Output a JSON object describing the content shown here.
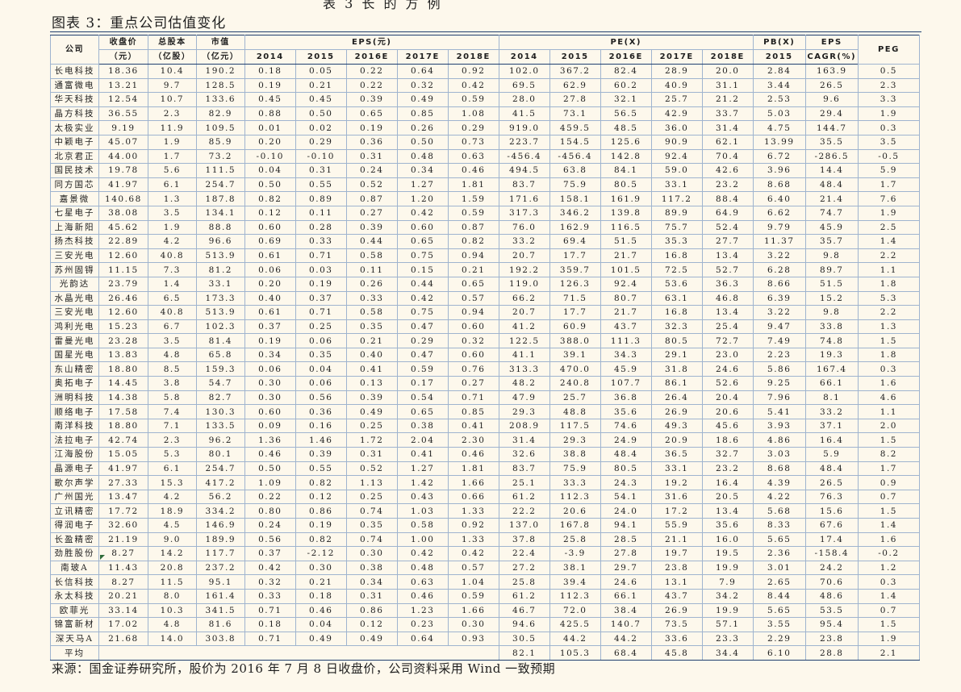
{
  "cut_title": "表 3 长 的 方 例",
  "figure_title": "图表 3：重点公司估值变化",
  "headers": {
    "company": "公司",
    "close_price": "收盘价",
    "close_price_unit": "（元）",
    "total_shares": "总股本",
    "total_shares_unit": "（亿股）",
    "market_cap": "市值",
    "market_cap_unit": "（亿元）",
    "eps_group": "EPS(元)",
    "pe_group": "PE(X)",
    "pb_group": "PB(X)",
    "pb_year": "2015",
    "eps_cagr": "EPS",
    "eps_cagr_unit": "CAGR(%)",
    "peg": "PEG",
    "years": [
      "2014",
      "2015",
      "2016E",
      "2017E",
      "2018E"
    ]
  },
  "rows": [
    [
      "长电科技",
      "18.36",
      "10.4",
      "190.2",
      "0.18",
      "0.05",
      "0.22",
      "0.64",
      "0.92",
      "102.0",
      "367.2",
      "82.4",
      "28.9",
      "20.0",
      "2.84",
      "163.9",
      "0.5"
    ],
    [
      "通富微电",
      "13.21",
      "9.7",
      "128.5",
      "0.19",
      "0.21",
      "0.22",
      "0.32",
      "0.42",
      "69.5",
      "62.9",
      "60.2",
      "40.9",
      "31.1",
      "3.44",
      "26.5",
      "2.3"
    ],
    [
      "华天科技",
      "12.54",
      "10.7",
      "133.6",
      "0.45",
      "0.45",
      "0.39",
      "0.49",
      "0.59",
      "28.0",
      "27.8",
      "32.1",
      "25.7",
      "21.2",
      "2.53",
      "9.6",
      "3.3"
    ],
    [
      "晶方科技",
      "36.55",
      "2.3",
      "82.9",
      "0.88",
      "0.50",
      "0.65",
      "0.85",
      "1.08",
      "41.5",
      "73.1",
      "56.5",
      "42.9",
      "33.7",
      "5.03",
      "29.4",
      "1.9"
    ],
    [
      "太极实业",
      "9.19",
      "11.9",
      "109.5",
      "0.01",
      "0.02",
      "0.19",
      "0.26",
      "0.29",
      "919.0",
      "459.5",
      "48.5",
      "36.0",
      "31.4",
      "4.75",
      "144.7",
      "0.3"
    ],
    [
      "中颖电子",
      "45.07",
      "1.9",
      "85.9",
      "0.20",
      "0.29",
      "0.36",
      "0.50",
      "0.73",
      "223.7",
      "154.5",
      "125.6",
      "90.9",
      "62.1",
      "13.99",
      "35.5",
      "3.5"
    ],
    [
      "北京君正",
      "44.00",
      "1.7",
      "73.2",
      "-0.10",
      "-0.10",
      "0.31",
      "0.48",
      "0.63",
      "-456.4",
      "-456.4",
      "142.8",
      "92.4",
      "70.4",
      "6.72",
      "-286.5",
      "-0.5"
    ],
    [
      "国民技术",
      "19.78",
      "5.6",
      "111.5",
      "0.04",
      "0.31",
      "0.24",
      "0.34",
      "0.46",
      "494.5",
      "63.8",
      "84.1",
      "59.0",
      "42.6",
      "3.96",
      "14.4",
      "5.9"
    ],
    [
      "同方国芯",
      "41.97",
      "6.1",
      "254.7",
      "0.50",
      "0.55",
      "0.52",
      "1.27",
      "1.81",
      "83.7",
      "75.9",
      "80.5",
      "33.1",
      "23.2",
      "8.68",
      "48.4",
      "1.7"
    ],
    [
      "嘉景微",
      "140.68",
      "1.3",
      "187.8",
      "0.82",
      "0.89",
      "0.87",
      "1.20",
      "1.59",
      "171.6",
      "158.1",
      "161.9",
      "117.2",
      "88.4",
      "6.40",
      "21.4",
      "7.6"
    ],
    [
      "七星电子",
      "38.08",
      "3.5",
      "134.1",
      "0.12",
      "0.11",
      "0.27",
      "0.42",
      "0.59",
      "317.3",
      "346.2",
      "139.8",
      "89.9",
      "64.9",
      "6.62",
      "74.7",
      "1.9"
    ],
    [
      "上海新阳",
      "45.62",
      "1.9",
      "88.8",
      "0.60",
      "0.28",
      "0.39",
      "0.60",
      "0.87",
      "76.0",
      "162.9",
      "116.5",
      "75.7",
      "52.4",
      "9.79",
      "45.9",
      "2.5"
    ],
    [
      "扬杰科技",
      "22.89",
      "4.2",
      "96.6",
      "0.69",
      "0.33",
      "0.44",
      "0.65",
      "0.82",
      "33.2",
      "69.4",
      "51.5",
      "35.3",
      "27.7",
      "11.37",
      "35.7",
      "1.4"
    ],
    [
      "三安光电",
      "12.60",
      "40.8",
      "513.9",
      "0.61",
      "0.71",
      "0.58",
      "0.75",
      "0.94",
      "20.7",
      "17.7",
      "21.7",
      "16.8",
      "13.4",
      "3.22",
      "9.8",
      "2.2"
    ],
    [
      "苏州固锝",
      "11.15",
      "7.3",
      "81.2",
      "0.06",
      "0.03",
      "0.11",
      "0.15",
      "0.21",
      "192.2",
      "359.7",
      "101.5",
      "72.5",
      "52.7",
      "6.28",
      "89.7",
      "1.1"
    ],
    [
      "光韵达",
      "23.79",
      "1.4",
      "33.1",
      "0.20",
      "0.19",
      "0.26",
      "0.44",
      "0.65",
      "119.0",
      "126.3",
      "92.4",
      "53.6",
      "36.3",
      "8.66",
      "51.5",
      "1.8"
    ],
    [
      "水晶光电",
      "26.46",
      "6.5",
      "173.3",
      "0.40",
      "0.37",
      "0.33",
      "0.42",
      "0.57",
      "66.2",
      "71.5",
      "80.7",
      "63.1",
      "46.8",
      "6.39",
      "15.2",
      "5.3"
    ],
    [
      "三安光电",
      "12.60",
      "40.8",
      "513.9",
      "0.61",
      "0.71",
      "0.58",
      "0.75",
      "0.94",
      "20.7",
      "17.7",
      "21.7",
      "16.8",
      "13.4",
      "3.22",
      "9.8",
      "2.2"
    ],
    [
      "鸿利光电",
      "15.23",
      "6.7",
      "102.3",
      "0.37",
      "0.25",
      "0.35",
      "0.47",
      "0.60",
      "41.2",
      "60.9",
      "43.7",
      "32.3",
      "25.4",
      "9.47",
      "33.8",
      "1.3"
    ],
    [
      "雷曼光电",
      "23.28",
      "3.5",
      "81.4",
      "0.19",
      "0.06",
      "0.21",
      "0.29",
      "0.32",
      "122.5",
      "388.0",
      "111.3",
      "80.5",
      "72.7",
      "7.49",
      "74.8",
      "1.5"
    ],
    [
      "国星光电",
      "13.83",
      "4.8",
      "65.8",
      "0.34",
      "0.35",
      "0.40",
      "0.47",
      "0.60",
      "41.1",
      "39.1",
      "34.3",
      "29.1",
      "23.0",
      "2.23",
      "19.3",
      "1.8"
    ],
    [
      "东山精密",
      "18.80",
      "8.5",
      "159.3",
      "0.06",
      "0.04",
      "0.41",
      "0.59",
      "0.76",
      "313.3",
      "470.0",
      "45.9",
      "31.8",
      "24.6",
      "5.86",
      "167.4",
      "0.3"
    ],
    [
      "奥拓电子",
      "14.45",
      "3.8",
      "54.7",
      "0.30",
      "0.06",
      "0.13",
      "0.17",
      "0.27",
      "48.2",
      "240.8",
      "107.7",
      "86.1",
      "52.6",
      "9.25",
      "66.1",
      "1.6"
    ],
    [
      "洲明科技",
      "14.38",
      "5.8",
      "82.7",
      "0.30",
      "0.56",
      "0.39",
      "0.54",
      "0.71",
      "47.9",
      "25.7",
      "36.8",
      "26.4",
      "20.4",
      "7.96",
      "8.1",
      "4.6"
    ],
    [
      "顺络电子",
      "17.58",
      "7.4",
      "130.3",
      "0.60",
      "0.36",
      "0.49",
      "0.65",
      "0.85",
      "29.3",
      "48.8",
      "35.6",
      "26.9",
      "20.6",
      "5.41",
      "33.2",
      "1.1"
    ],
    [
      "南洋科技",
      "18.80",
      "7.1",
      "133.5",
      "0.09",
      "0.16",
      "0.25",
      "0.38",
      "0.41",
      "208.9",
      "117.5",
      "74.6",
      "49.3",
      "45.6",
      "3.93",
      "37.1",
      "2.0"
    ],
    [
      "法拉电子",
      "42.74",
      "2.3",
      "96.2",
      "1.36",
      "1.46",
      "1.72",
      "2.04",
      "2.30",
      "31.4",
      "29.3",
      "24.9",
      "20.9",
      "18.6",
      "4.86",
      "16.4",
      "1.5"
    ],
    [
      "江海股份",
      "15.05",
      "5.3",
      "80.1",
      "0.46",
      "0.39",
      "0.31",
      "0.41",
      "0.46",
      "32.6",
      "38.8",
      "48.4",
      "36.5",
      "32.7",
      "3.03",
      "5.9",
      "8.2"
    ],
    [
      "晶源电子",
      "41.97",
      "6.1",
      "254.7",
      "0.50",
      "0.55",
      "0.52",
      "1.27",
      "1.81",
      "83.7",
      "75.9",
      "80.5",
      "33.1",
      "23.2",
      "8.68",
      "48.4",
      "1.7"
    ],
    [
      "歌尔声学",
      "27.33",
      "15.3",
      "417.2",
      "1.09",
      "0.82",
      "1.13",
      "1.42",
      "1.66",
      "25.1",
      "33.3",
      "24.3",
      "19.2",
      "16.4",
      "4.39",
      "26.5",
      "0.9"
    ],
    [
      "广州国光",
      "13.47",
      "4.2",
      "56.2",
      "0.22",
      "0.12",
      "0.25",
      "0.43",
      "0.66",
      "61.2",
      "112.3",
      "54.1",
      "31.6",
      "20.5",
      "4.22",
      "76.3",
      "0.7"
    ],
    [
      "立讯精密",
      "17.72",
      "18.9",
      "334.2",
      "0.80",
      "0.86",
      "0.74",
      "1.03",
      "1.33",
      "22.2",
      "20.6",
      "24.0",
      "17.2",
      "13.4",
      "5.68",
      "15.6",
      "1.5"
    ],
    [
      "得润电子",
      "32.60",
      "4.5",
      "146.9",
      "0.24",
      "0.19",
      "0.35",
      "0.58",
      "0.92",
      "137.0",
      "167.8",
      "94.1",
      "55.9",
      "35.6",
      "8.33",
      "67.6",
      "1.4"
    ],
    [
      "长盈精密",
      "21.19",
      "9.0",
      "189.9",
      "0.56",
      "0.82",
      "0.74",
      "1.00",
      "1.33",
      "37.8",
      "25.8",
      "28.5",
      "21.1",
      "16.0",
      "5.65",
      "17.4",
      "1.6"
    ],
    [
      "劲胜股份",
      "8.27",
      "14.2",
      "117.7",
      "0.37",
      "-2.12",
      "0.30",
      "0.42",
      "0.42",
      "22.4",
      "-3.9",
      "27.8",
      "19.7",
      "19.5",
      "2.36",
      "-158.4",
      "-0.2"
    ],
    [
      "南玻A",
      "11.43",
      "20.8",
      "237.2",
      "0.42",
      "0.30",
      "0.38",
      "0.48",
      "0.57",
      "27.2",
      "38.1",
      "29.7",
      "23.8",
      "19.9",
      "3.01",
      "24.2",
      "1.2"
    ],
    [
      "长信科技",
      "8.27",
      "11.5",
      "95.1",
      "0.32",
      "0.21",
      "0.34",
      "0.63",
      "1.04",
      "25.8",
      "39.4",
      "24.6",
      "13.1",
      "7.9",
      "2.65",
      "70.6",
      "0.3"
    ],
    [
      "永太科技",
      "20.21",
      "8.0",
      "161.4",
      "0.33",
      "0.18",
      "0.31",
      "0.46",
      "0.59",
      "61.2",
      "112.3",
      "66.1",
      "43.7",
      "34.2",
      "8.44",
      "48.6",
      "1.4"
    ],
    [
      "欧菲光",
      "33.14",
      "10.3",
      "341.5",
      "0.71",
      "0.46",
      "0.86",
      "1.23",
      "1.66",
      "46.7",
      "72.0",
      "38.4",
      "26.9",
      "19.9",
      "5.65",
      "53.5",
      "0.7"
    ],
    [
      "锦富新材",
      "17.02",
      "4.8",
      "81.6",
      "0.18",
      "0.04",
      "0.12",
      "0.23",
      "0.30",
      "94.6",
      "425.5",
      "140.7",
      "73.5",
      "57.1",
      "3.55",
      "95.4",
      "1.5"
    ],
    [
      "深天马A",
      "21.68",
      "14.0",
      "303.8",
      "0.71",
      "0.49",
      "0.49",
      "0.64",
      "0.93",
      "30.5",
      "44.2",
      "44.2",
      "33.6",
      "23.3",
      "2.29",
      "23.8",
      "1.9"
    ]
  ],
  "average": {
    "label": "平均",
    "values": [
      "82.1",
      "105.3",
      "68.4",
      "45.8",
      "34.4",
      "6.10",
      "28.8",
      "2.1"
    ]
  },
  "source": "来源：国金证券研究所，股价为 2016 年 7 月 8 日收盘价，公司资料采用 Wind 一致预期"
}
